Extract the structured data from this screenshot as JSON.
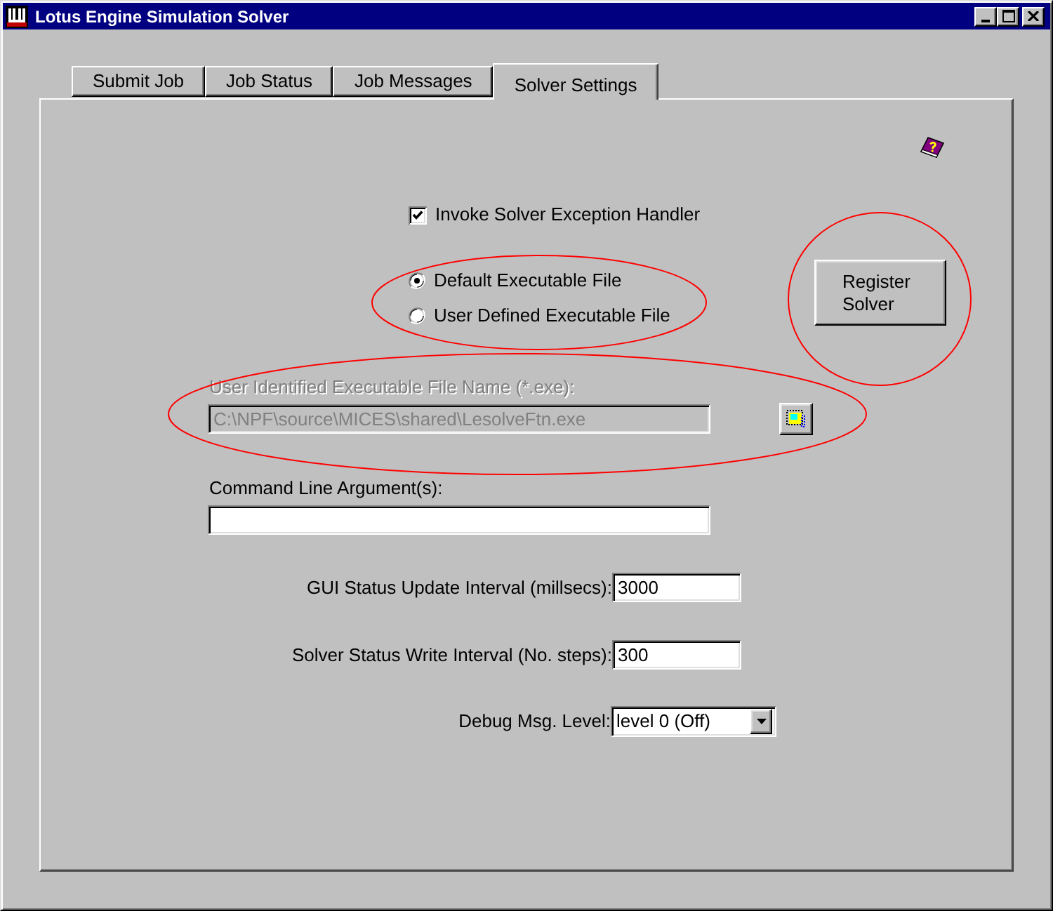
{
  "window": {
    "title": "Lotus Engine Simulation Solver"
  },
  "tabs": [
    {
      "label": "Submit Job",
      "selected": false
    },
    {
      "label": "Job Status",
      "selected": false
    },
    {
      "label": "Job Messages",
      "selected": false
    },
    {
      "label": "Solver Settings",
      "selected": true
    }
  ],
  "exception_handler": {
    "label": "Invoke Solver Exception Handler",
    "checked": true
  },
  "executable_options": [
    {
      "label": "Default Executable File",
      "selected": true
    },
    {
      "label": "User Defined Executable File",
      "selected": false
    }
  ],
  "register_button": {
    "label": "Register Solver"
  },
  "executable_file": {
    "label": "User Identified Executable File Name (*.exe):",
    "value": "C:\\NPF\\source\\MICES\\shared\\LesolveFtn.exe",
    "disabled": true
  },
  "command_line": {
    "label": "Command Line Argument(s):"
  },
  "gui_update_interval": {
    "label": "GUI Status Update Interval (millsecs):",
    "value": "3000"
  },
  "solver_write_interval": {
    "label": "Solver Status Write Interval (No. steps):",
    "value": "300"
  },
  "debug_level": {
    "label": "Debug Msg. Level:",
    "value": "level 0 (Off)"
  }
}
